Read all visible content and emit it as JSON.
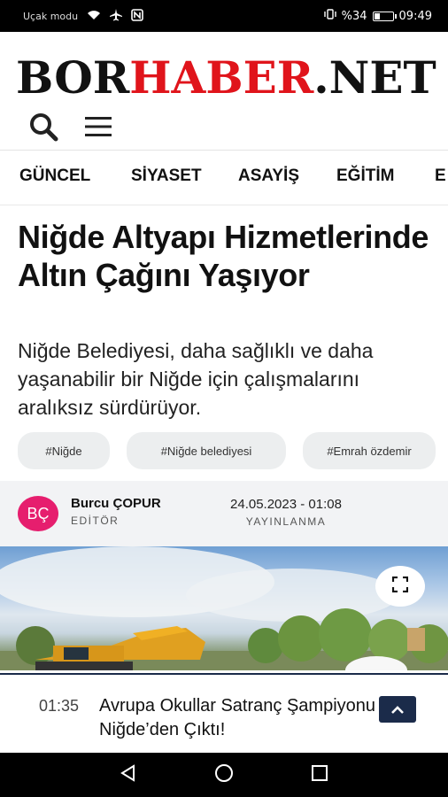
{
  "status_bar": {
    "carrier": "Uçak modu",
    "battery_text": "%34",
    "battery_level": 0.34,
    "time": "09:49"
  },
  "header": {
    "logo_part1": "BOR",
    "logo_part2": "HABER",
    "logo_part3": ".NET",
    "logo_black": "#111111",
    "logo_red": "#e0141b",
    "search_icon": "search-icon",
    "menu_icon": "hamburger-menu-icon"
  },
  "nav": {
    "items": [
      {
        "label": "GÜNCEL"
      },
      {
        "label": "SİYASET"
      },
      {
        "label": "ASAYİŞ"
      },
      {
        "label": "EĞİTİM"
      },
      {
        "label": "E"
      }
    ]
  },
  "article": {
    "title": "Niğde Altyapı Hizmetlerinde Altın Çağını Yaşıyor",
    "summary": "Niğde Belediyesi, daha sağlıklı ve daha yaşanabilir bir Niğde için çalışmalarını aralıksız sürdürüyor.",
    "tags": [
      {
        "label": "#Niğde"
      },
      {
        "label": "#Niğde belediyesi"
      },
      {
        "label": "#Emrah özdemir"
      }
    ],
    "author": {
      "initials": "BÇ",
      "name": "Burcu ÇOPUR",
      "role": "EDİTÖR",
      "avatar_color": "#e61e6e"
    },
    "published": {
      "date": "24.05.2023 - 01:08",
      "label": "YAYINLANMA"
    },
    "hero_fullscreen_icon": "fullscreen-icon"
  },
  "ticker": {
    "time": "01:35",
    "text": "Avrupa Okullar Satranç Şampiyonu Niğde’den Çıktı!",
    "up_icon": "chevron-up-icon",
    "accent": "#1b2b4a"
  },
  "android_nav": {
    "back_icon": "back-triangle-icon",
    "home_icon": "home-circle-icon",
    "recents_icon": "recents-square-icon"
  }
}
